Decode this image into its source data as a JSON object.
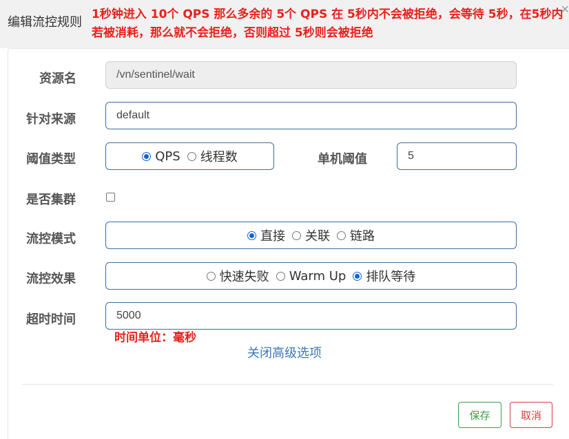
{
  "dialog": {
    "title": "编辑流控规则",
    "annotation": "1秒钟进入 10个 QPS 那么多余的 5个 QPS 在 5秒内不会被拒绝，会等待 5秒，在5秒内若被消耗，那么就不会拒绝，否则超过 5秒则会被拒绝",
    "close_icon": "×"
  },
  "form": {
    "resource": {
      "label": "资源名",
      "value": "/vn/sentinel/wait"
    },
    "source": {
      "label": "针对来源",
      "value": "default"
    },
    "threshold_type": {
      "label": "阈值类型",
      "options": [
        {
          "label": "QPS",
          "checked": true
        },
        {
          "label": "线程数",
          "checked": false
        }
      ]
    },
    "single_threshold": {
      "label": "单机阈值",
      "value": "5"
    },
    "cluster": {
      "label": "是否集群",
      "checked": false
    },
    "control_mode": {
      "label": "流控模式",
      "options": [
        {
          "label": "直接",
          "checked": true
        },
        {
          "label": "关联",
          "checked": false
        },
        {
          "label": "链路",
          "checked": false
        }
      ]
    },
    "control_effect": {
      "label": "流控效果",
      "options": [
        {
          "label": "快速失败",
          "checked": false
        },
        {
          "label": "Warm Up",
          "checked": false
        },
        {
          "label": "排队等待",
          "checked": true
        }
      ]
    },
    "timeout": {
      "label": "超时时间",
      "value": "5000",
      "unit_note": "时间单位：毫秒"
    },
    "advanced_toggle": "关闭高级选项"
  },
  "footer": {
    "save_label": "保存",
    "cancel_label": "取消"
  },
  "colors": {
    "accent": "#3c6e9f",
    "annotation_red": "#e8211c",
    "save_green": "#3f9b46",
    "cancel_red": "#d43f3a",
    "radio_blue": "#0b63d6",
    "link_blue": "#3c79b5"
  }
}
